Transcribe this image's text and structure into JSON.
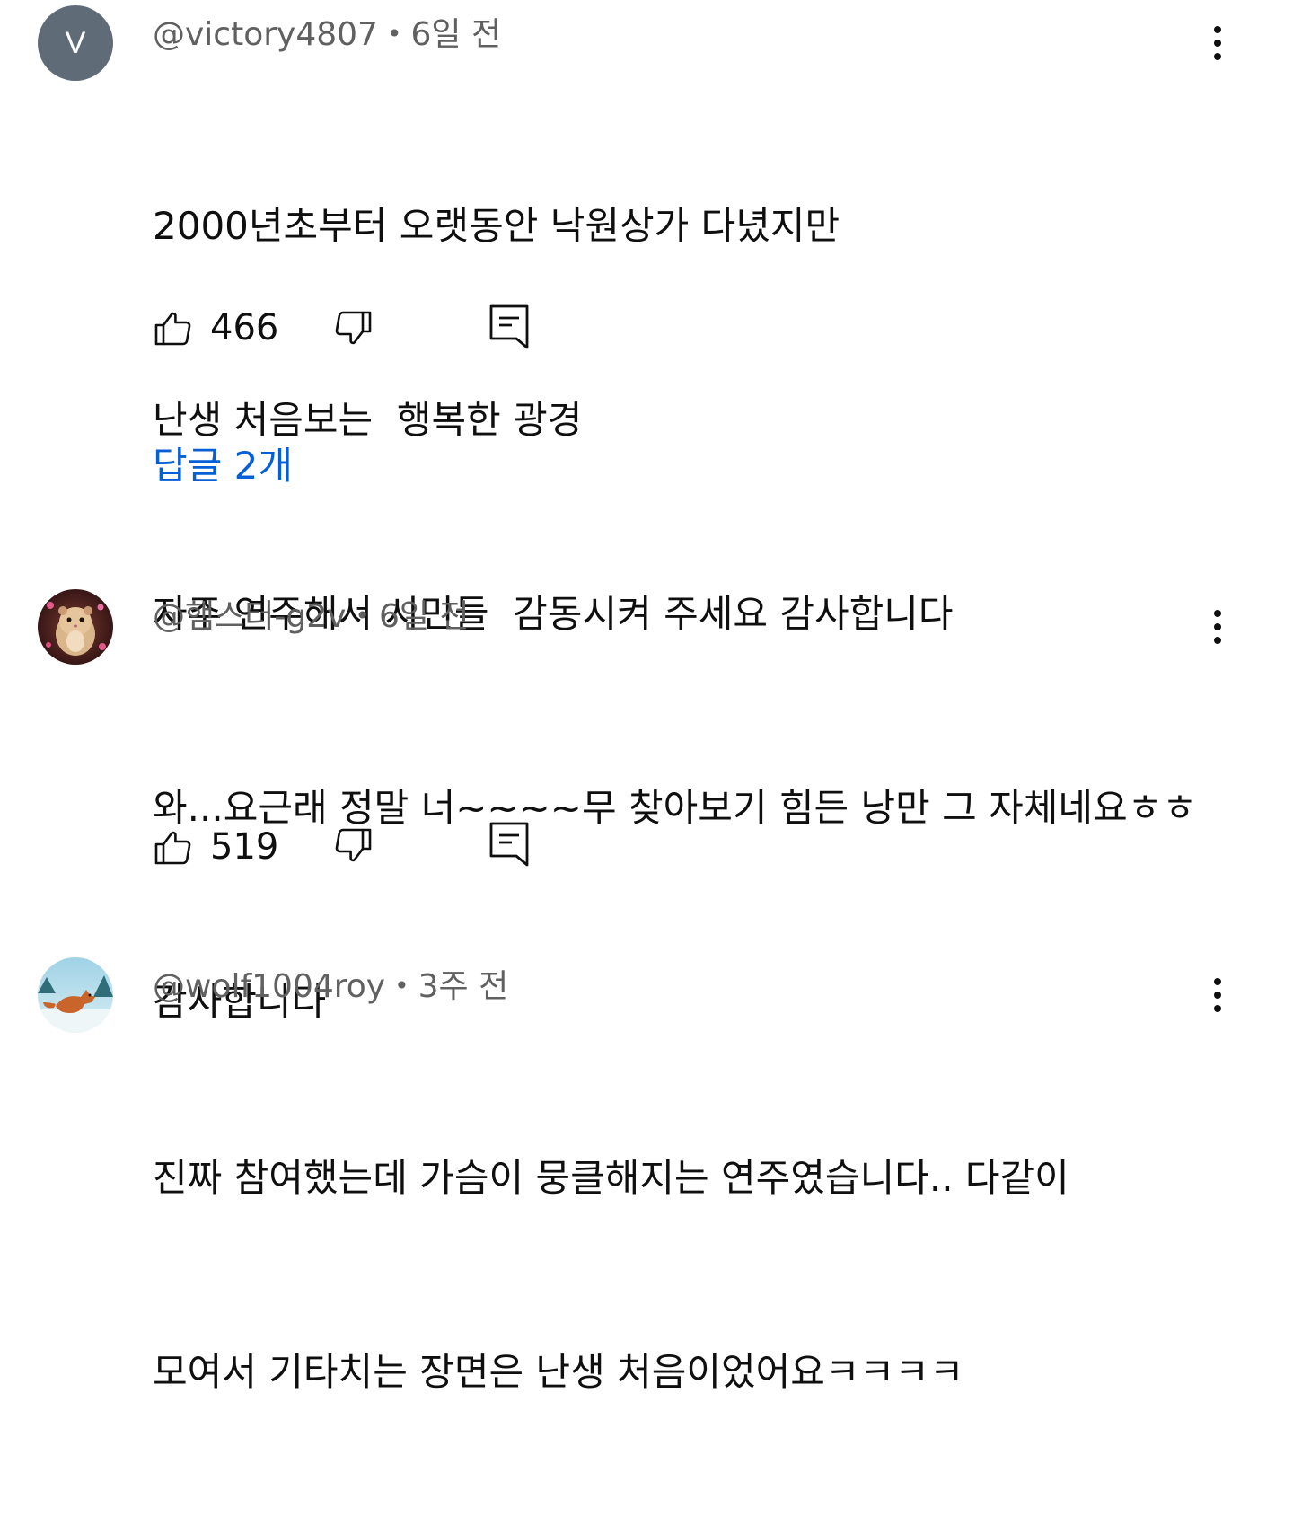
{
  "comments": [
    {
      "avatar_letter": "V",
      "author": "@victory4807",
      "separator": "•",
      "time": "6일 전",
      "lines": [
        "2000년초부터 오랫동안 낙원상가 다녔지만",
        "난생 처음보는  행복한 광경",
        "자주 연주해서 시민들  감동시켜 주세요 감사합니다"
      ],
      "like_count": "466",
      "replies_label": "답글 2개"
    },
    {
      "avatar_letter": "",
      "author": "@햄스터-g2v",
      "separator": "•",
      "time": "6일 전",
      "lines": [
        "와...요근래 정말 너~~~~무 찾아보기 힘든 낭만 그 자체네요ㅎㅎ",
        "감사합니다"
      ],
      "like_count": "519"
    },
    {
      "avatar_letter": "",
      "author": "@wolf1004roy",
      "separator": "•",
      "time": "3주 전",
      "lines": [
        "진짜 참여했는데 가슴이 뭉클해지는 연주였습니다.. 다같이",
        "모여서 기타치는 장면은 난생 처음이었어요ㅋㅋㅋㅋ"
      ]
    }
  ],
  "icons": {
    "like": "thumbs-up-icon",
    "dislike": "thumbs-down-icon",
    "reply": "reply-icon",
    "more": "more-vert-icon"
  },
  "colors": {
    "text": "#0f0f0f",
    "meta": "#606060",
    "link": "#065fd4",
    "avatar_bg": "#5f6b76"
  }
}
